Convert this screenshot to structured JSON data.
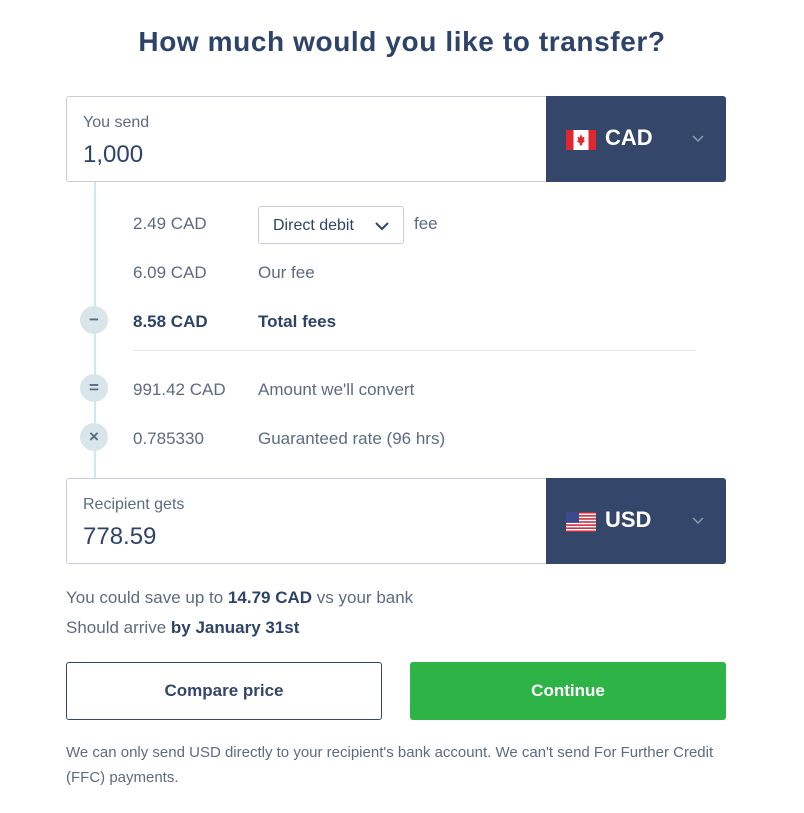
{
  "title": "How much would you like to transfer?",
  "send": {
    "label": "You send",
    "value": "1,000",
    "currency": "CAD",
    "flag_icon": "canada-flag-icon"
  },
  "fees": {
    "payment_fee_amount": "2.49 CAD",
    "payment_method": "Direct debit",
    "payment_fee_label": "fee",
    "our_fee_amount": "6.09 CAD",
    "our_fee_label": "Our fee",
    "total_symbol": "−",
    "total_amount": "8.58 CAD",
    "total_label": "Total fees",
    "convert_symbol": "=",
    "convert_amount": "991.42 CAD",
    "convert_label": "Amount we'll convert",
    "rate_symbol": "×",
    "rate_value": "0.785330",
    "rate_label": "Guaranteed rate (96 hrs)"
  },
  "receive": {
    "label": "Recipient gets",
    "value": "778.59",
    "currency": "USD",
    "flag_icon": "us-flag-icon"
  },
  "savings": {
    "prefix": "You could save up to",
    "amount": "14.79 CAD",
    "suffix": "vs your bank"
  },
  "arrival": {
    "prefix": "Should arrive",
    "date": "by January 31st"
  },
  "buttons": {
    "compare": "Compare price",
    "continue": "Continue"
  },
  "note": "We can only send USD directly to your recipient's bank account. We can't send For Further Credit (FFC) payments.",
  "colors": {
    "heading": "#2e4369",
    "currency_bg": "#34466a",
    "continue_bg": "#2eb347",
    "timeline": "#c7eaf3"
  }
}
